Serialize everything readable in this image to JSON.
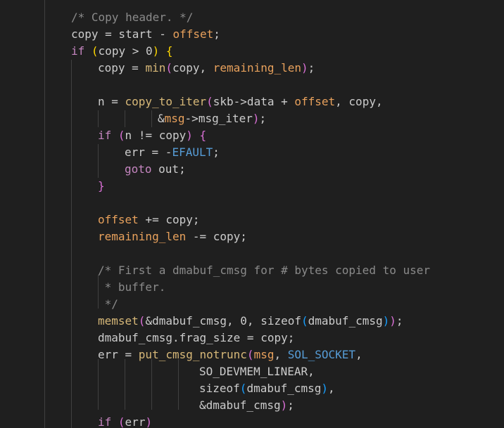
{
  "editor": {
    "lines": [
      {
        "indent": 101,
        "tokens": [
          {
            "t": "/* Copy header. */",
            "k": "comment"
          }
        ]
      },
      {
        "indent": 101,
        "tokens": [
          {
            "t": "copy = start - ",
            "k": "plain"
          },
          {
            "t": "offset",
            "k": "var"
          },
          {
            "t": ";",
            "k": "plain"
          }
        ]
      },
      {
        "indent": 101,
        "tokens": [
          {
            "t": "if",
            "k": "keyword"
          },
          {
            "t": " ",
            "k": "plain"
          },
          {
            "t": "(",
            "k": "bracket1"
          },
          {
            "t": "copy > 0",
            "k": "plain"
          },
          {
            "t": ")",
            "k": "bracket1"
          },
          {
            "t": " ",
            "k": "plain"
          },
          {
            "t": "{",
            "k": "bracket1"
          }
        ]
      },
      {
        "indent": 139,
        "tokens": [
          {
            "t": "copy = ",
            "k": "plain"
          },
          {
            "t": "min",
            "k": "func"
          },
          {
            "t": "(",
            "k": "bracket2"
          },
          {
            "t": "copy, ",
            "k": "plain"
          },
          {
            "t": "remaining_len",
            "k": "var"
          },
          {
            "t": ")",
            "k": "bracket2"
          },
          {
            "t": ";",
            "k": "plain"
          }
        ]
      },
      {
        "indent": 139,
        "tokens": []
      },
      {
        "indent": 139,
        "tokens": [
          {
            "t": "n = ",
            "k": "plain"
          },
          {
            "t": "copy_to_iter",
            "k": "func"
          },
          {
            "t": "(",
            "k": "bracket2"
          },
          {
            "t": "skb->data + ",
            "k": "plain"
          },
          {
            "t": "offset",
            "k": "var"
          },
          {
            "t": ", copy,",
            "k": "plain"
          }
        ]
      },
      {
        "indent": 224,
        "tokens": [
          {
            "t": "&",
            "k": "plain"
          },
          {
            "t": "msg",
            "k": "var"
          },
          {
            "t": "->msg_iter",
            "k": "plain"
          },
          {
            "t": ")",
            "k": "bracket2"
          },
          {
            "t": ";",
            "k": "plain"
          }
        ]
      },
      {
        "indent": 139,
        "tokens": [
          {
            "t": "if",
            "k": "keyword"
          },
          {
            "t": " ",
            "k": "plain"
          },
          {
            "t": "(",
            "k": "bracket2"
          },
          {
            "t": "n != copy",
            "k": "plain"
          },
          {
            "t": ")",
            "k": "bracket2"
          },
          {
            "t": " ",
            "k": "plain"
          },
          {
            "t": "{",
            "k": "bracket2"
          }
        ]
      },
      {
        "indent": 177,
        "tokens": [
          {
            "t": "err = -",
            "k": "plain"
          },
          {
            "t": "EFAULT",
            "k": "macro"
          },
          {
            "t": ";",
            "k": "plain"
          }
        ]
      },
      {
        "indent": 177,
        "tokens": [
          {
            "t": "goto",
            "k": "keyword"
          },
          {
            "t": " out;",
            "k": "plain"
          }
        ]
      },
      {
        "indent": 139,
        "tokens": [
          {
            "t": "}",
            "k": "bracket2"
          }
        ]
      },
      {
        "indent": 139,
        "tokens": []
      },
      {
        "indent": 139,
        "tokens": [
          {
            "t": "offset",
            "k": "var"
          },
          {
            "t": " += copy;",
            "k": "plain"
          }
        ]
      },
      {
        "indent": 139,
        "tokens": [
          {
            "t": "remaining_len",
            "k": "var"
          },
          {
            "t": " -= copy;",
            "k": "plain"
          }
        ]
      },
      {
        "indent": 139,
        "tokens": []
      },
      {
        "indent": 139,
        "tokens": [
          {
            "t": "/* First a dmabuf_cmsg for # bytes copied to user",
            "k": "comment"
          }
        ]
      },
      {
        "indent": 139,
        "tokens": [
          {
            "t": " * buffer.",
            "k": "comment"
          }
        ]
      },
      {
        "indent": 139,
        "tokens": [
          {
            "t": " */",
            "k": "comment"
          }
        ]
      },
      {
        "indent": 139,
        "tokens": [
          {
            "t": "memset",
            "k": "func"
          },
          {
            "t": "(",
            "k": "bracket2"
          },
          {
            "t": "&dmabuf_cmsg, 0, ",
            "k": "plain"
          },
          {
            "t": "sizeof",
            "k": "const"
          },
          {
            "t": "(",
            "k": "bracket3"
          },
          {
            "t": "dmabuf_cmsg",
            "k": "plain"
          },
          {
            "t": ")",
            "k": "bracket3"
          },
          {
            "t": ")",
            "k": "bracket2"
          },
          {
            "t": ";",
            "k": "plain"
          }
        ]
      },
      {
        "indent": 139,
        "tokens": [
          {
            "t": "dmabuf_cmsg.frag_size = copy;",
            "k": "plain"
          }
        ]
      },
      {
        "indent": 139,
        "tokens": [
          {
            "t": "err = ",
            "k": "plain"
          },
          {
            "t": "put_cmsg_notrunc",
            "k": "func"
          },
          {
            "t": "(",
            "k": "bracket2"
          },
          {
            "t": "msg",
            "k": "var"
          },
          {
            "t": ", ",
            "k": "plain"
          },
          {
            "t": "SOL_SOCKET",
            "k": "macro"
          },
          {
            "t": ",",
            "k": "plain"
          }
        ]
      },
      {
        "indent": 283,
        "tokens": [
          {
            "t": "SO_DEVMEM_LINEAR,",
            "k": "plain"
          }
        ]
      },
      {
        "indent": 283,
        "tokens": [
          {
            "t": "sizeof",
            "k": "const"
          },
          {
            "t": "(",
            "k": "bracket3"
          },
          {
            "t": "dmabuf_cmsg",
            "k": "plain"
          },
          {
            "t": ")",
            "k": "bracket3"
          },
          {
            "t": ",",
            "k": "plain"
          }
        ]
      },
      {
        "indent": 283,
        "tokens": [
          {
            "t": "&dmabuf_cmsg",
            "k": "plain"
          },
          {
            "t": ")",
            "k": "bracket2"
          },
          {
            "t": ";",
            "k": "plain"
          }
        ]
      },
      {
        "indent": 139,
        "tokens": [
          {
            "t": "if",
            "k": "keyword"
          },
          {
            "t": " ",
            "k": "plain"
          },
          {
            "t": "(",
            "k": "bracket2"
          },
          {
            "t": "err",
            "k": "plain"
          },
          {
            "t": ")",
            "k": "bracket2"
          }
        ]
      }
    ]
  },
  "colors": {
    "background": "#1f1f1f",
    "plain": "#cccccc",
    "comment": "#8a8a8a",
    "keyword": "#c586c0",
    "func": "#d7b878",
    "var": "#e8a15c",
    "macro": "#569cd6",
    "bracket1": "#ffd700",
    "bracket2": "#da70d6",
    "bracket3": "#179fff"
  }
}
